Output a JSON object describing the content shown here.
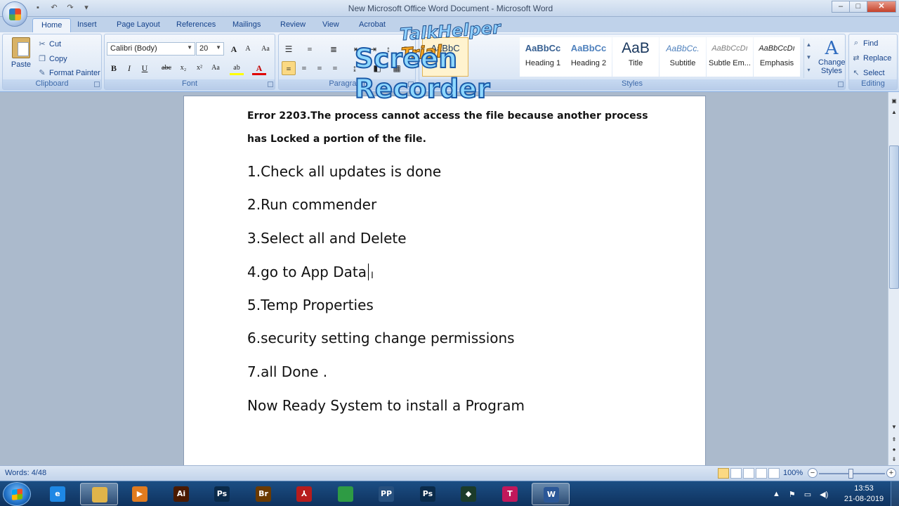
{
  "window": {
    "title": "New Microsoft Office Word Document - Microsoft Word",
    "controls": {
      "minimize": "–",
      "maximize": "□",
      "close": "✕"
    }
  },
  "quick_access": [
    "save-icon",
    "undo-icon",
    "redo-icon",
    "customize-icon"
  ],
  "tabs": [
    "Home",
    "Insert",
    "Page Layout",
    "References",
    "Mailings",
    "Review",
    "View",
    "Acrobat"
  ],
  "clipboard": {
    "paste": "Paste",
    "cut": "Cut",
    "copy": "Copy",
    "format_painter": "Format Painter",
    "label": "Clipboard"
  },
  "font": {
    "family": "Calibri (Body)",
    "size": "20",
    "grow": "A",
    "shrink": "A",
    "clear": "Aa",
    "bold": "B",
    "italic": "I",
    "underline": "U",
    "strike": "abc",
    "subscript": "x₂",
    "superscript": "x²",
    "change_case": "Aa",
    "highlight": "ab",
    "color": "A",
    "label": "Font"
  },
  "paragraph": {
    "label": "Paragraph",
    "show_marks": "¶"
  },
  "styles": {
    "label": "Styles",
    "items": [
      {
        "sample": "AaBbC",
        "name": ""
      },
      {
        "sample": "AaBbCc",
        "name": "Heading 1"
      },
      {
        "sample": "AaBbCc",
        "name": "Heading 2"
      },
      {
        "sample": "AaB",
        "name": "Title"
      },
      {
        "sample": "AaBbCc.",
        "name": "Subtitle"
      },
      {
        "sample": "AaBbCcDı",
        "name": "Subtle Em..."
      },
      {
        "sample": "AaBbCcDı",
        "name": "Emphasis"
      }
    ],
    "change_styles": "Change Styles"
  },
  "editing": {
    "find": "Find",
    "replace": "Replace",
    "select": "Select",
    "label": "Editing"
  },
  "watermark": {
    "line1": "TalkHelper",
    "trial": "Trial",
    "line2": "Screen Recorder"
  },
  "document": {
    "error_line1": "Error 2203.The process cannot access the file because another process",
    "error_line2": "has Locked a portion of the file.",
    "steps": [
      "1.Check all updates is done",
      "2.Run commender",
      "3.Select all and Delete",
      "4.go to App Data",
      "5.Temp Properties",
      "6.security setting change permissions",
      "7.all Done .",
      "Now Ready System to install a Program"
    ]
  },
  "status": {
    "words": "Words: 4/48",
    "zoom": "100%",
    "zoom_minus": "−",
    "zoom_plus": "+"
  },
  "taskbar": {
    "apps": [
      {
        "name": "internet-explorer",
        "glyph": "e",
        "color": "#1e88e5"
      },
      {
        "name": "file-explorer",
        "glyph": "",
        "color": "#e0b44a"
      },
      {
        "name": "media-player",
        "glyph": "▶",
        "color": "#e07b1f"
      },
      {
        "name": "illustrator",
        "glyph": "Ai",
        "color": "#4a1a00"
      },
      {
        "name": "photoshop",
        "glyph": "Ps",
        "color": "#0a2a4a"
      },
      {
        "name": "bridge",
        "glyph": "Br",
        "color": "#6b3a00"
      },
      {
        "name": "acrobat",
        "glyph": "⅄",
        "color": "#b71c1c"
      },
      {
        "name": "chrome",
        "glyph": "",
        "color": "#2e9b44"
      },
      {
        "name": "presenter",
        "glyph": "PP",
        "color": "#27507e"
      },
      {
        "name": "photoshop-2",
        "glyph": "Ps",
        "color": "#0a2a4a"
      },
      {
        "name": "filmora",
        "glyph": "◆",
        "color": "#1b3b2a"
      },
      {
        "name": "talkhelper",
        "glyph": "T",
        "color": "#c2185b"
      },
      {
        "name": "word",
        "glyph": "W",
        "color": "#2b5797"
      }
    ],
    "time": "13:53",
    "date": "21-08-2019"
  }
}
